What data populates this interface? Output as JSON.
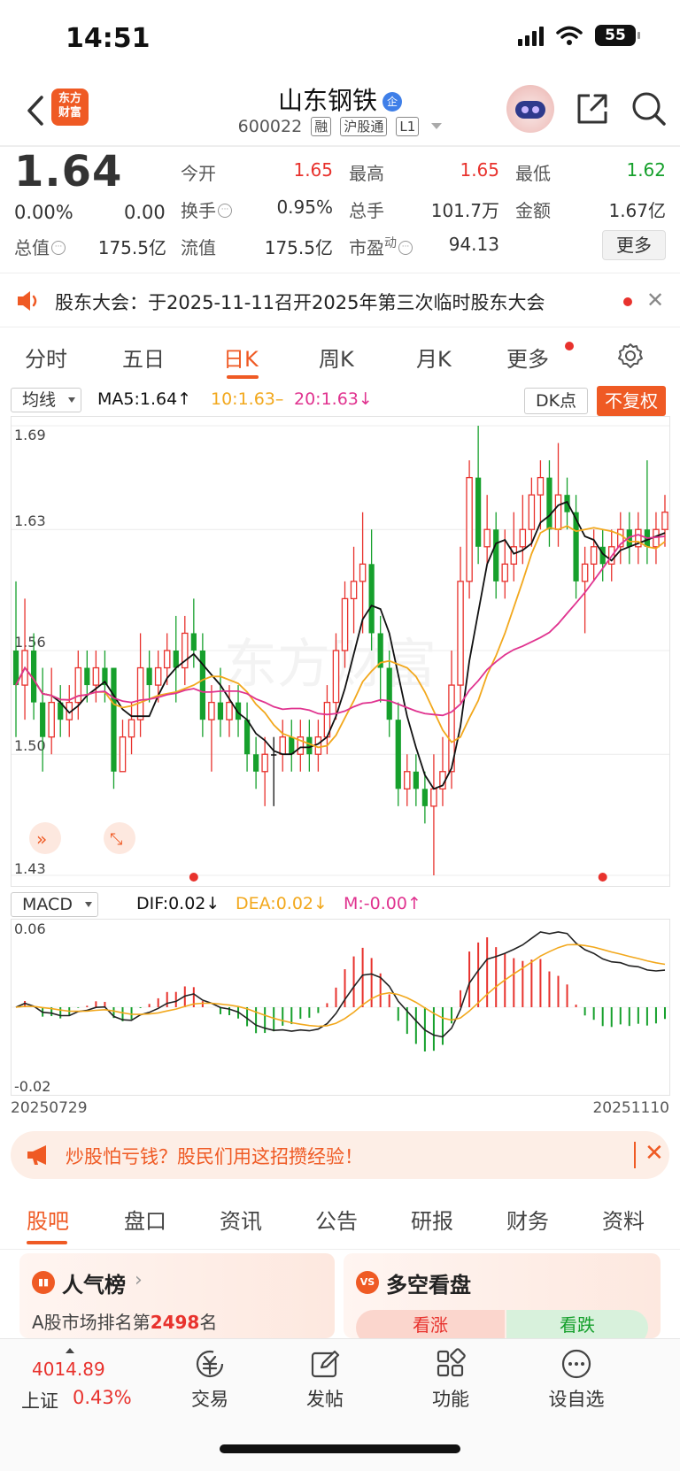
{
  "status": {
    "time": "14:51",
    "battery": "55"
  },
  "header": {
    "logo": [
      "东方",
      "财富"
    ],
    "name": "山东钢铁",
    "badge": "企",
    "code": "600022",
    "tags": [
      "融",
      "沪股通",
      "L1"
    ]
  },
  "quote": {
    "price": "1.64",
    "change_pct": "0.00%",
    "change_amt": "0.00",
    "fields": [
      {
        "label": "今开",
        "value": "1.65",
        "tone": "up"
      },
      {
        "label": "最高",
        "value": "1.65",
        "tone": "up"
      },
      {
        "label": "最低",
        "value": "1.62",
        "tone": "down"
      },
      {
        "label": "换手",
        "value": "0.95%",
        "tone": "flat"
      },
      {
        "label": "总手",
        "value": "101.7万",
        "tone": "flat"
      },
      {
        "label": "金额",
        "value": "1.67亿",
        "tone": "flat"
      },
      {
        "label": "总值",
        "value": "175.5亿",
        "tone": "flat"
      },
      {
        "label": "流值",
        "value": "175.5亿",
        "tone": "flat"
      },
      {
        "label": "市盈",
        "value": "94.13",
        "tone": "flat",
        "sup": "动"
      }
    ],
    "more": "更多"
  },
  "notice": {
    "text": "股东大会：于2025-11-11召开2025年第三次临时股东大会"
  },
  "period_tabs": [
    "分时",
    "五日",
    "日K",
    "周K",
    "月K",
    "更多"
  ],
  "active_period": 2,
  "ma_bar": {
    "select": "均线",
    "ma5": "MA5:1.64",
    "ma10": "10:1.63",
    "ma20": "20:1.63",
    "dk": "DK点",
    "fq": "不复权"
  },
  "macd_bar": {
    "select": "MACD",
    "dif": "DIF:0.02",
    "dea": "DEA:0.02",
    "m": "M:-0.00"
  },
  "colors": {
    "up": "#e8322d",
    "down": "#16a02c",
    "accent": "#ef5a24",
    "ma5": "#111111",
    "ma10": "#f2a81d",
    "ma20": "#e0338f"
  },
  "chart_data": [
    {
      "type": "candlestick",
      "ylim": [
        1.43,
        1.69
      ],
      "y_ticks": [
        "1.69",
        "1.63",
        "1.56",
        "1.50",
        "1.43"
      ],
      "x_range": [
        "20250729",
        "20251110"
      ],
      "candles": [
        [
          1.56,
          1.54,
          1.6,
          1.51
        ],
        [
          1.54,
          1.56,
          1.59,
          1.52
        ],
        [
          1.56,
          1.53,
          1.57,
          1.52
        ],
        [
          1.53,
          1.51,
          1.55,
          1.49
        ],
        [
          1.51,
          1.53,
          1.55,
          1.5
        ],
        [
          1.53,
          1.52,
          1.54,
          1.51
        ],
        [
          1.52,
          1.53,
          1.54,
          1.51
        ],
        [
          1.53,
          1.55,
          1.56,
          1.52
        ],
        [
          1.55,
          1.54,
          1.56,
          1.53
        ],
        [
          1.54,
          1.55,
          1.56,
          1.53
        ],
        [
          1.55,
          1.54,
          1.56,
          1.53
        ],
        [
          1.55,
          1.49,
          1.55,
          1.48
        ],
        [
          1.49,
          1.51,
          1.52,
          1.49
        ],
        [
          1.51,
          1.52,
          1.53,
          1.5
        ],
        [
          1.52,
          1.55,
          1.57,
          1.51
        ],
        [
          1.55,
          1.54,
          1.56,
          1.53
        ],
        [
          1.54,
          1.55,
          1.56,
          1.53
        ],
        [
          1.55,
          1.56,
          1.57,
          1.54
        ],
        [
          1.56,
          1.55,
          1.58,
          1.53
        ],
        [
          1.55,
          1.57,
          1.58,
          1.54
        ],
        [
          1.57,
          1.56,
          1.59,
          1.55
        ],
        [
          1.56,
          1.52,
          1.57,
          1.51
        ],
        [
          1.52,
          1.53,
          1.54,
          1.49
        ],
        [
          1.53,
          1.52,
          1.55,
          1.51
        ],
        [
          1.52,
          1.53,
          1.54,
          1.51
        ],
        [
          1.53,
          1.52,
          1.54,
          1.51
        ],
        [
          1.52,
          1.5,
          1.53,
          1.49
        ],
        [
          1.5,
          1.49,
          1.51,
          1.48
        ],
        [
          1.49,
          1.5,
          1.51,
          1.47
        ],
        [
          1.5,
          1.5,
          1.51,
          1.47
        ],
        [
          1.5,
          1.51,
          1.52,
          1.49
        ],
        [
          1.51,
          1.5,
          1.52,
          1.49
        ],
        [
          1.5,
          1.51,
          1.52,
          1.49
        ],
        [
          1.51,
          1.5,
          1.52,
          1.49
        ],
        [
          1.5,
          1.51,
          1.52,
          1.49
        ],
        [
          1.51,
          1.53,
          1.54,
          1.5
        ],
        [
          1.53,
          1.56,
          1.57,
          1.52
        ],
        [
          1.56,
          1.59,
          1.6,
          1.55
        ],
        [
          1.59,
          1.6,
          1.62,
          1.57
        ],
        [
          1.6,
          1.61,
          1.64,
          1.57
        ],
        [
          1.61,
          1.57,
          1.63,
          1.56
        ],
        [
          1.57,
          1.55,
          1.58,
          1.53
        ],
        [
          1.55,
          1.52,
          1.56,
          1.51
        ],
        [
          1.52,
          1.48,
          1.53,
          1.47
        ],
        [
          1.48,
          1.49,
          1.5,
          1.47
        ],
        [
          1.49,
          1.48,
          1.5,
          1.47
        ],
        [
          1.48,
          1.47,
          1.49,
          1.46
        ],
        [
          1.47,
          1.48,
          1.5,
          1.43
        ],
        [
          1.48,
          1.49,
          1.51,
          1.47
        ],
        [
          1.49,
          1.54,
          1.56,
          1.48
        ],
        [
          1.54,
          1.6,
          1.62,
          1.53
        ],
        [
          1.6,
          1.66,
          1.67,
          1.59
        ],
        [
          1.66,
          1.62,
          1.69,
          1.61
        ],
        [
          1.62,
          1.63,
          1.65,
          1.61
        ],
        [
          1.63,
          1.6,
          1.64,
          1.59
        ],
        [
          1.6,
          1.61,
          1.63,
          1.59
        ],
        [
          1.61,
          1.62,
          1.64,
          1.6
        ],
        [
          1.62,
          1.63,
          1.65,
          1.61
        ],
        [
          1.63,
          1.65,
          1.66,
          1.62
        ],
        [
          1.65,
          1.66,
          1.67,
          1.63
        ],
        [
          1.66,
          1.63,
          1.67,
          1.62
        ],
        [
          1.63,
          1.65,
          1.68,
          1.62
        ],
        [
          1.65,
          1.64,
          1.66,
          1.63
        ],
        [
          1.64,
          1.6,
          1.65,
          1.59
        ],
        [
          1.6,
          1.61,
          1.62,
          1.57
        ],
        [
          1.61,
          1.62,
          1.63,
          1.6
        ],
        [
          1.62,
          1.61,
          1.63,
          1.6
        ],
        [
          1.61,
          1.62,
          1.63,
          1.6
        ],
        [
          1.62,
          1.63,
          1.64,
          1.61
        ],
        [
          1.63,
          1.62,
          1.64,
          1.61
        ],
        [
          1.62,
          1.63,
          1.64,
          1.61
        ],
        [
          1.63,
          1.62,
          1.67,
          1.61
        ],
        [
          1.62,
          1.63,
          1.64,
          1.61
        ],
        [
          1.63,
          1.64,
          1.65,
          1.62
        ]
      ],
      "markers": [
        20,
        66
      ]
    },
    {
      "type": "macd",
      "ylim": [
        -0.02,
        0.06
      ],
      "y_ticks": [
        "0.06",
        "-0.02"
      ]
    }
  ],
  "dates": {
    "start": "20250729",
    "end": "20251110"
  },
  "ad": {
    "text": "炒股怕亏钱？股民们用这招攒经验！"
  },
  "content_tabs": [
    "股吧",
    "盘口",
    "资讯",
    "公告",
    "研报",
    "财务",
    "资料"
  ],
  "cards": {
    "popularity": {
      "title": "人气榜",
      "prefix": "A股市场排名第",
      "rank": "2498",
      "suffix": "名"
    },
    "vote": {
      "title": "多空看盘",
      "up": "看涨",
      "down": "看跌"
    }
  },
  "bottom": {
    "index_value": "4014.89",
    "index_name": "上证",
    "index_pct": "0.43%",
    "nav": [
      "交易",
      "发帖",
      "功能",
      "设自选"
    ]
  }
}
